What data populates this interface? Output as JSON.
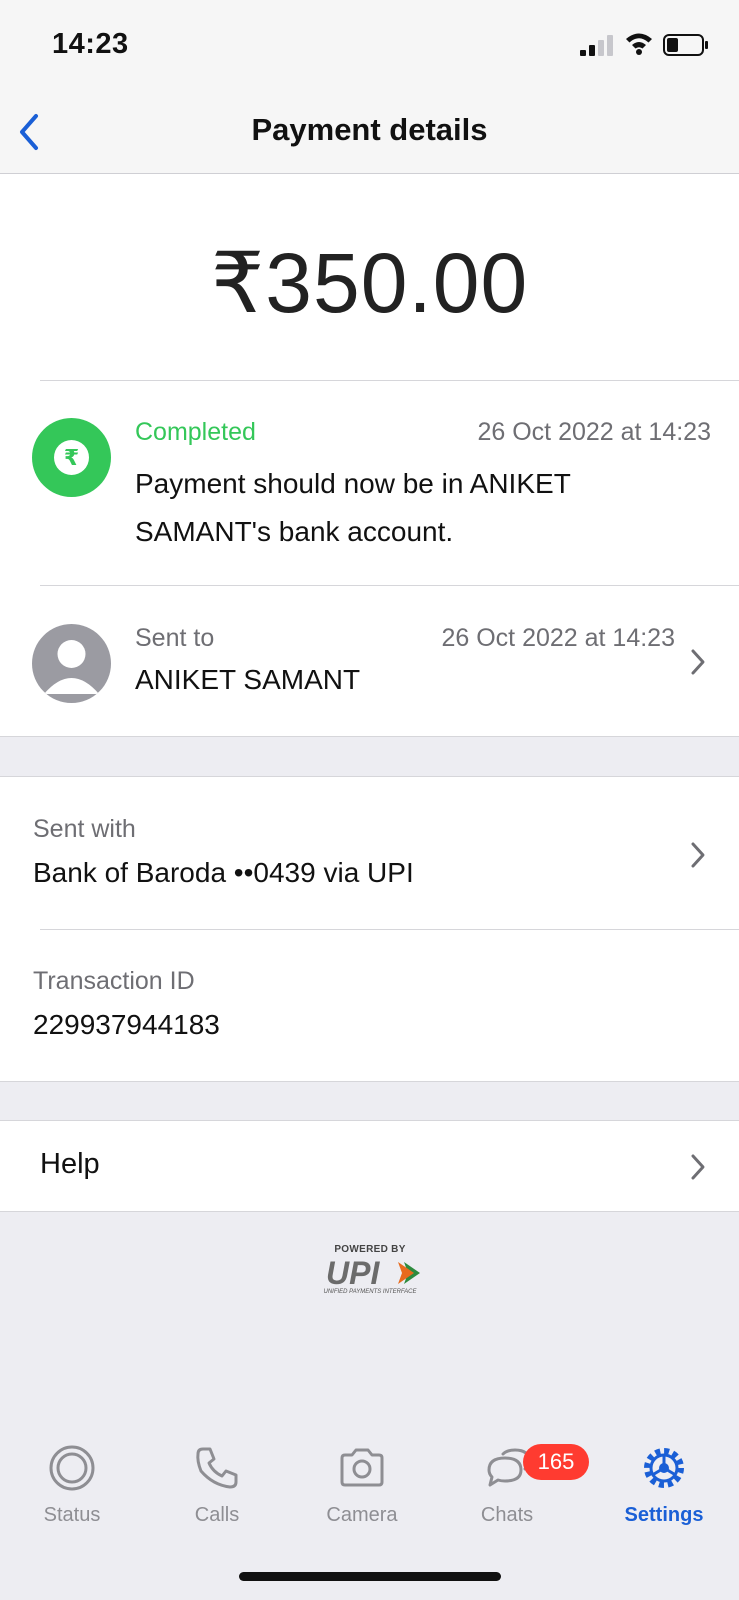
{
  "status_bar": {
    "time": "14:23"
  },
  "nav": {
    "title": "Payment details"
  },
  "payment": {
    "amount": "₹350.00",
    "currency_symbol": "₹",
    "status": "Completed",
    "status_time": "26 Oct 2022 at 14:23",
    "status_message": "Payment should now be in ANIKET SAMANT's bank account."
  },
  "recipient": {
    "label": "Sent to",
    "time": "26 Oct 2022 at 14:23",
    "name": "ANIKET SAMANT"
  },
  "sent_with": {
    "label": "Sent with",
    "value": "Bank of Baroda ••0439 via UPI"
  },
  "transaction": {
    "label": "Transaction ID",
    "value": "229937944183"
  },
  "help": {
    "label": "Help"
  },
  "upi_logo": {
    "powered_by": "POWERED BY",
    "mark": "UPI",
    "subtitle": "UNIFIED PAYMENTS INTERFACE"
  },
  "tabs": [
    {
      "label": "Status",
      "icon": "status-icon"
    },
    {
      "label": "Calls",
      "icon": "phone-icon"
    },
    {
      "label": "Camera",
      "icon": "camera-icon"
    },
    {
      "label": "Chats",
      "icon": "chat-bubbles-icon",
      "badge": "165"
    },
    {
      "label": "Settings",
      "icon": "gear-icon",
      "active": true
    }
  ],
  "colors": {
    "success_green": "#34c759",
    "accent_blue": "#1a5fd6",
    "badge_red": "#ff3b30"
  }
}
